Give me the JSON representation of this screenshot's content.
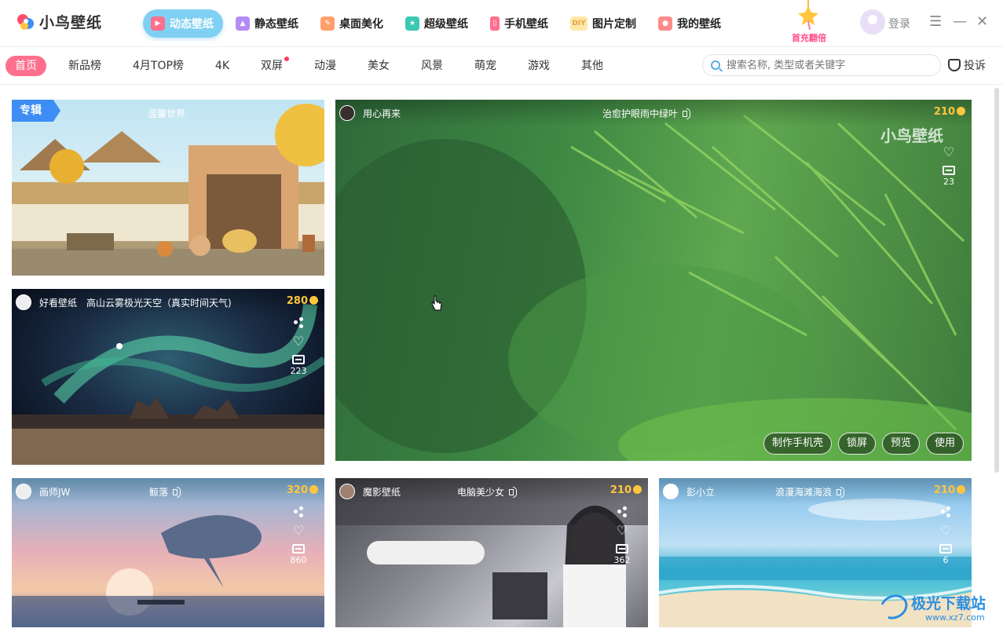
{
  "app": {
    "name": "小鸟壁纸"
  },
  "nav": [
    {
      "label": "动态壁纸",
      "icon": "play-icon",
      "color": "#ff6f8e",
      "active": true
    },
    {
      "label": "静态壁纸",
      "icon": "image-icon",
      "color": "#b48cf5"
    },
    {
      "label": "桌面美化",
      "icon": "brush-icon",
      "color": "#ff9f6b"
    },
    {
      "label": "超级壁纸",
      "icon": "star-icon",
      "color": "#3cc8b4"
    },
    {
      "label": "手机壁纸",
      "icon": "phone-icon",
      "color": "#ff6f8e"
    },
    {
      "label": "图片定制",
      "icon": "diy-icon",
      "color": "#ffd36b",
      "badge": "DIY"
    },
    {
      "label": "我的壁纸",
      "icon": "user-icon",
      "color": "#ff8a8a"
    }
  ],
  "promo": {
    "label": "首充翻倍"
  },
  "account": {
    "login": "登录"
  },
  "window": {
    "menu": "☰",
    "minimize": "—",
    "close": "✕"
  },
  "categories": [
    {
      "label": "首页",
      "active": true
    },
    {
      "label": "新品榜"
    },
    {
      "label": "4月TOP榜"
    },
    {
      "label": "4K"
    },
    {
      "label": "双屏",
      "dot": true
    },
    {
      "label": "动漫"
    },
    {
      "label": "美女"
    },
    {
      "label": "风景"
    },
    {
      "label": "萌宠"
    },
    {
      "label": "游戏"
    },
    {
      "label": "其他"
    }
  ],
  "search": {
    "placeholder": "搜索名称, 类型或者关键字"
  },
  "report": {
    "label": "投诉"
  },
  "cards": {
    "album": {
      "tag": "专辑",
      "title": "温馨世界"
    },
    "aurora": {
      "author": "好看壁纸",
      "title": "高山云雾极光天空（真实时间天气)",
      "price": "280",
      "comments": "223"
    },
    "featured": {
      "author": "用心再来",
      "title": "治愈护眼雨中绿叶",
      "price": "210",
      "comments": "23",
      "watermark": "小鸟壁纸",
      "actions": [
        "制作手机壳",
        "锁屏",
        "预览",
        "使用"
      ]
    },
    "whale": {
      "author": "画师JW",
      "title": "鲸落",
      "price": "320",
      "comments": "860"
    },
    "girl": {
      "author": "魔影壁纸",
      "title": "电脑美少女",
      "price": "210",
      "comments": "362"
    },
    "beach": {
      "author": "彭小立",
      "title": "浪漫海滩海浪",
      "price": "210",
      "comments": "6"
    }
  },
  "site_watermark": {
    "name": "极光下载站",
    "url": "www.xz7.com"
  }
}
